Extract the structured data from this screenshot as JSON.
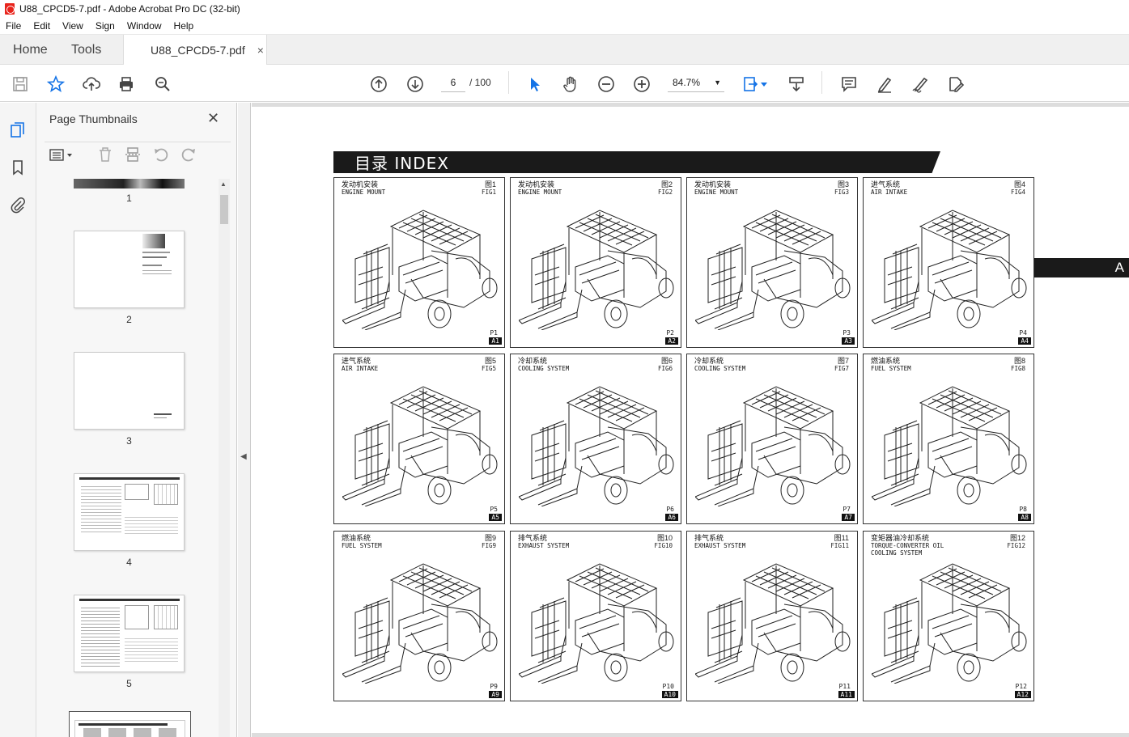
{
  "window": {
    "title": "U88_CPCD5-7.pdf - Adobe Acrobat Pro DC (32-bit)"
  },
  "menu": [
    "File",
    "Edit",
    "View",
    "Sign",
    "Window",
    "Help"
  ],
  "tabs": {
    "home": "Home",
    "tools": "Tools",
    "doc": "U88_CPCD5-7.pdf",
    "close": "×"
  },
  "toolbar": {
    "page_current": "6",
    "page_total": "/ 100",
    "zoom": "84.7%"
  },
  "panel": {
    "title": "Page Thumbnails",
    "close": "✕",
    "thumbs": [
      "1",
      "2",
      "3",
      "4",
      "5"
    ]
  },
  "document": {
    "index_title": "目录  INDEX",
    "side_tab": "A",
    "cells": [
      {
        "cn": "发动机安装",
        "en": "ENGINE MOUNT",
        "fcn": "图1",
        "fen": "FIG1",
        "page": "P1",
        "a": "A1"
      },
      {
        "cn": "发动机安装",
        "en": "ENGINE MOUNT",
        "fcn": "图2",
        "fen": "FIG2",
        "page": "P2",
        "a": "A2"
      },
      {
        "cn": "发动机安装",
        "en": "ENGINE MOUNT",
        "fcn": "图3",
        "fen": "FIG3",
        "page": "P3",
        "a": "A3"
      },
      {
        "cn": "进气系统",
        "en": "AIR INTAKE",
        "fcn": "图4",
        "fen": "FIG4",
        "page": "P4",
        "a": "A4"
      },
      {
        "cn": "进气系统",
        "en": "AIR INTAKE",
        "fcn": "图5",
        "fen": "FIG5",
        "page": "P5",
        "a": "A5"
      },
      {
        "cn": "冷却系统",
        "en": "COOLING SYSTEM",
        "fcn": "图6",
        "fen": "FIG6",
        "page": "P6",
        "a": "A6"
      },
      {
        "cn": "冷却系统",
        "en": "COOLING SYSTEM",
        "fcn": "图7",
        "fen": "FIG7",
        "page": "P7",
        "a": "A7"
      },
      {
        "cn": "燃油系统",
        "en": "FUEL SYSTEM",
        "fcn": "图8",
        "fen": "FIG8",
        "page": "P8",
        "a": "A8"
      },
      {
        "cn": "燃油系统",
        "en": "FUEL SYSTEM",
        "fcn": "图9",
        "fen": "FIG9",
        "page": "P9",
        "a": "A9"
      },
      {
        "cn": "排气系统",
        "en": "EXHAUST SYSTEM",
        "fcn": "图10",
        "fen": "FIG10",
        "page": "P10",
        "a": "A10"
      },
      {
        "cn": "排气系统",
        "en": "EXHAUST SYSTEM",
        "fcn": "图11",
        "fen": "FIG11",
        "page": "P11",
        "a": "A11"
      },
      {
        "cn": "变矩器油冷却系统",
        "en": "TORQUE-CONVERTER OIL\nCOOLING SYSTEM",
        "fcn": "图12",
        "fen": "FIG12",
        "page": "P12",
        "a": "A12"
      }
    ]
  }
}
